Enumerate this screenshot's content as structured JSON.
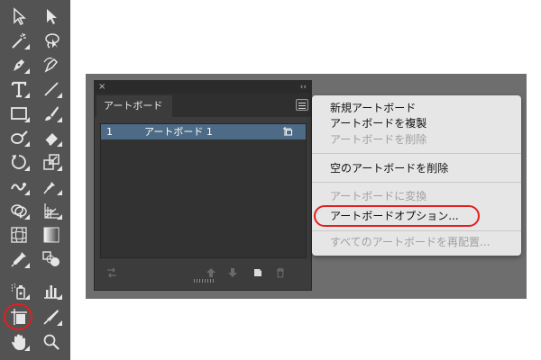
{
  "colors": {
    "toolbar_bg": "#535353",
    "highlight_ring": "#e02020",
    "selected_row": "#4d6a86"
  },
  "tools": [
    {
      "name": "selection-tool",
      "icon": "arrow-outline-icon"
    },
    {
      "name": "direct-selection-tool",
      "icon": "arrow-filled-icon"
    },
    {
      "name": "magic-wand-tool",
      "icon": "magic-wand-icon"
    },
    {
      "name": "lasso-tool",
      "icon": "lasso-icon"
    },
    {
      "name": "pen-tool",
      "icon": "pen-nib-icon"
    },
    {
      "name": "curvature-tool",
      "icon": "curvature-pen-icon"
    },
    {
      "name": "type-tool",
      "icon": "type-t-icon"
    },
    {
      "name": "line-tool",
      "icon": "line-segment-icon"
    },
    {
      "name": "rectangle-tool",
      "icon": "rectangle-icon"
    },
    {
      "name": "paintbrush-tool",
      "icon": "paintbrush-icon"
    },
    {
      "name": "shaper-tool",
      "icon": "blob-brush-icon"
    },
    {
      "name": "eraser-tool",
      "icon": "eraser-icon"
    },
    {
      "name": "rotate-tool",
      "icon": "rotate-icon"
    },
    {
      "name": "scale-tool",
      "icon": "scale-icon"
    },
    {
      "name": "warp-tool",
      "icon": "warp-icon"
    },
    {
      "name": "puppet-warp-tool",
      "icon": "pushpin-icon"
    },
    {
      "name": "shape-builder-tool",
      "icon": "shape-builder-icon"
    },
    {
      "name": "perspective-grid-tool",
      "icon": "perspective-grid-icon"
    },
    {
      "name": "mesh-tool",
      "icon": "mesh-icon"
    },
    {
      "name": "gradient-tool",
      "icon": "gradient-icon"
    },
    {
      "name": "eyedropper-tool",
      "icon": "eyedropper-icon"
    },
    {
      "name": "blend-tool",
      "icon": "blend-icon"
    },
    {
      "name": "symbol-sprayer-tool",
      "icon": "symbol-sprayer-icon"
    },
    {
      "name": "column-graph-tool",
      "icon": "column-graph-icon"
    },
    {
      "name": "artboard-tool",
      "icon": "artboard-icon"
    },
    {
      "name": "slice-tool",
      "icon": "slice-knife-icon"
    },
    {
      "name": "hand-tool",
      "icon": "hand-icon"
    },
    {
      "name": "zoom-tool",
      "icon": "magnifier-icon"
    }
  ],
  "panel": {
    "tab_label": "アートボード",
    "close_glyph": "×",
    "collapse_glyph": "‹‹",
    "rows": [
      {
        "number": "1",
        "name": "アートボード 1"
      }
    ]
  },
  "menu": {
    "items": [
      {
        "label": "新規アートボード",
        "enabled": true
      },
      {
        "label": "アートボードを複製",
        "enabled": true
      },
      {
        "label": "アートボードを削除",
        "enabled": false
      },
      {
        "label": "空のアートボードを削除",
        "enabled": true
      },
      {
        "label": "アートボードに変換",
        "enabled": false
      },
      {
        "label": "アートボードオプション...",
        "enabled": true
      },
      {
        "label": "すべてのアートボードを再配置...",
        "enabled": false
      }
    ]
  }
}
